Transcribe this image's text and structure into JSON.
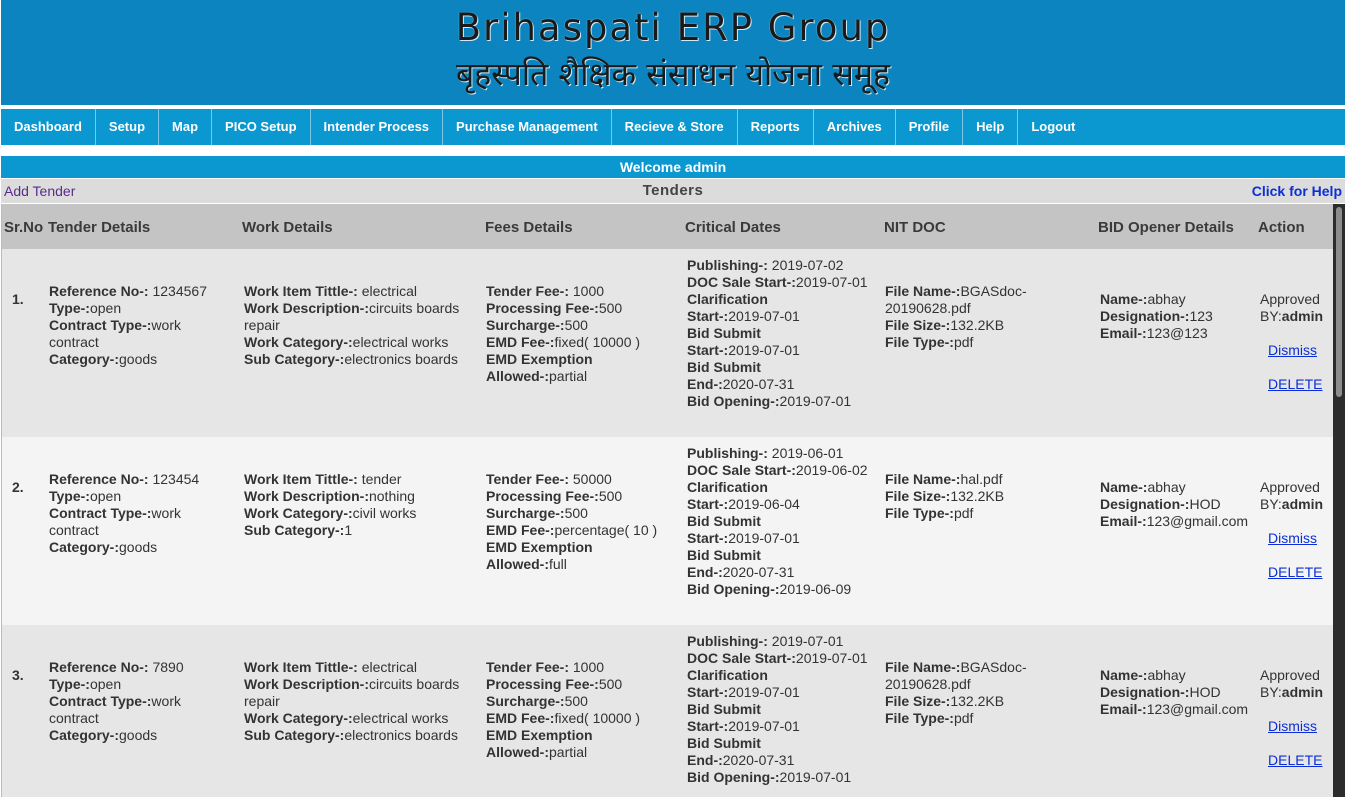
{
  "header": {
    "title_en": "Brihaspati ERP Group",
    "title_hi": "बृहस्पति शैक्षिक संसाधन योजना समूह",
    "bg_color": "#0B84BF"
  },
  "nav": {
    "color": "#0B98D0",
    "items": [
      "Dashboard",
      "Setup",
      "Map",
      "PICO Setup",
      "Intender Process",
      "Purchase Management",
      "Recieve & Store",
      "Reports",
      "Archives",
      "Profile",
      "Help",
      "Logout"
    ]
  },
  "welcome": "Welcome admin",
  "toolbar": {
    "add_tender": "Add Tender",
    "title": "Tenders",
    "help": "Click for Help"
  },
  "table": {
    "headers": {
      "srno": "Sr.No",
      "tender": "Tender Details",
      "work": "Work Details",
      "fees": "Fees Details",
      "dates": "Critical Dates",
      "nit": "NIT DOC",
      "bid": "BID Opener Details",
      "action": "Action"
    },
    "labels": {
      "ref": "Reference No-:",
      "type": "Type-:",
      "contract": "Contract Type-:",
      "category": "Category-:",
      "work_title": "Work Item Tittle-:",
      "work_desc": "Work Description-:",
      "work_cat": "Work Category-:",
      "sub_cat": "Sub Category-:",
      "tender_fee": "Tender Fee-:",
      "proc_fee": "Processing Fee-:",
      "surcharge": "Surcharge-:",
      "emd_fee": "EMD Fee-:",
      "emd_ex": "EMD Exemption",
      "allowed": "Allowed-:",
      "publishing": "Publishing-:",
      "doc_sale": "DOC Sale Start-:",
      "clar": "Clarification",
      "start": "Start-:",
      "bid_submit": "Bid Submit",
      "end": "End-:",
      "bid_opening": "Bid Opening-:",
      "file_name": "File Name-:",
      "file_size": "File Size-:",
      "file_type": "File Type-:",
      "name": "Name-:",
      "designation": "Designation-:",
      "email": "Email-:",
      "approved": "Approved",
      "by": "BY:",
      "dismiss": "Dismiss",
      "delete": "DELETE"
    },
    "rows": [
      {
        "srno": "1.",
        "ref": "1234567",
        "type": "open",
        "contract_1": "work",
        "contract_2": "contract",
        "category": "goods",
        "work_title": "electrical",
        "work_desc_1": "circuits boards",
        "work_desc_2": "repair",
        "work_cat": "electrical works",
        "sub_cat": "electronics boards",
        "tender_fee": "1000",
        "proc_fee": "500",
        "surcharge": "500",
        "emd_fee": "fixed( 10000 )",
        "allowed": "partial",
        "publishing": "2019-07-02",
        "doc_sale": "2019-07-01",
        "clar_start": "2019-07-01",
        "bid_start": "2019-07-01",
        "bid_end": "2020-07-31",
        "bid_opening": "2019-07-01",
        "file_name_1": "BGASdoc-",
        "file_name_2": "20190628.pdf",
        "file_size": "132.2KB",
        "file_type": "pdf",
        "name": "abhay",
        "designation": "123",
        "email": "123@123",
        "approved_by": "admin"
      },
      {
        "srno": "2.",
        "ref": "123454",
        "type": "open",
        "contract_1": "work",
        "contract_2": "contract",
        "category": "goods",
        "work_title": "tender",
        "work_desc_1": "nothing",
        "work_desc_2": "",
        "work_cat": "civil works",
        "sub_cat": "1",
        "tender_fee": "50000",
        "proc_fee": "500",
        "surcharge": "500",
        "emd_fee": "percentage( 10 )",
        "allowed": "full",
        "publishing": "2019-06-01",
        "doc_sale": "2019-06-02",
        "clar_start": "2019-06-04",
        "bid_start": "2019-07-01",
        "bid_end": "2020-07-31",
        "bid_opening": "2019-06-09",
        "file_name_1": "hal.pdf",
        "file_name_2": "",
        "file_size": "132.2KB",
        "file_type": "pdf",
        "name": "abhay",
        "designation": "HOD",
        "email": "123@gmail.com",
        "approved_by": "admin"
      },
      {
        "srno": "3.",
        "ref": "7890",
        "type": "open",
        "contract_1": "work",
        "contract_2": "contract",
        "category": "goods",
        "work_title": "electrical",
        "work_desc_1": "circuits boards",
        "work_desc_2": "repair",
        "work_cat": "electrical works",
        "sub_cat": "electronics boards",
        "tender_fee": "1000",
        "proc_fee": "500",
        "surcharge": "500",
        "emd_fee": "fixed( 10000 )",
        "allowed": "partial",
        "publishing": "2019-07-01",
        "doc_sale": "2019-07-01",
        "clar_start": "2019-07-01",
        "bid_start": "2019-07-01",
        "bid_end": "2020-07-31",
        "bid_opening": "2019-07-01",
        "file_name_1": "BGASdoc-",
        "file_name_2": "20190628.pdf",
        "file_size": "132.2KB",
        "file_type": "pdf",
        "name": "abhay",
        "designation": "HOD",
        "email": "123@gmail.com",
        "approved_by": "admin"
      }
    ]
  }
}
